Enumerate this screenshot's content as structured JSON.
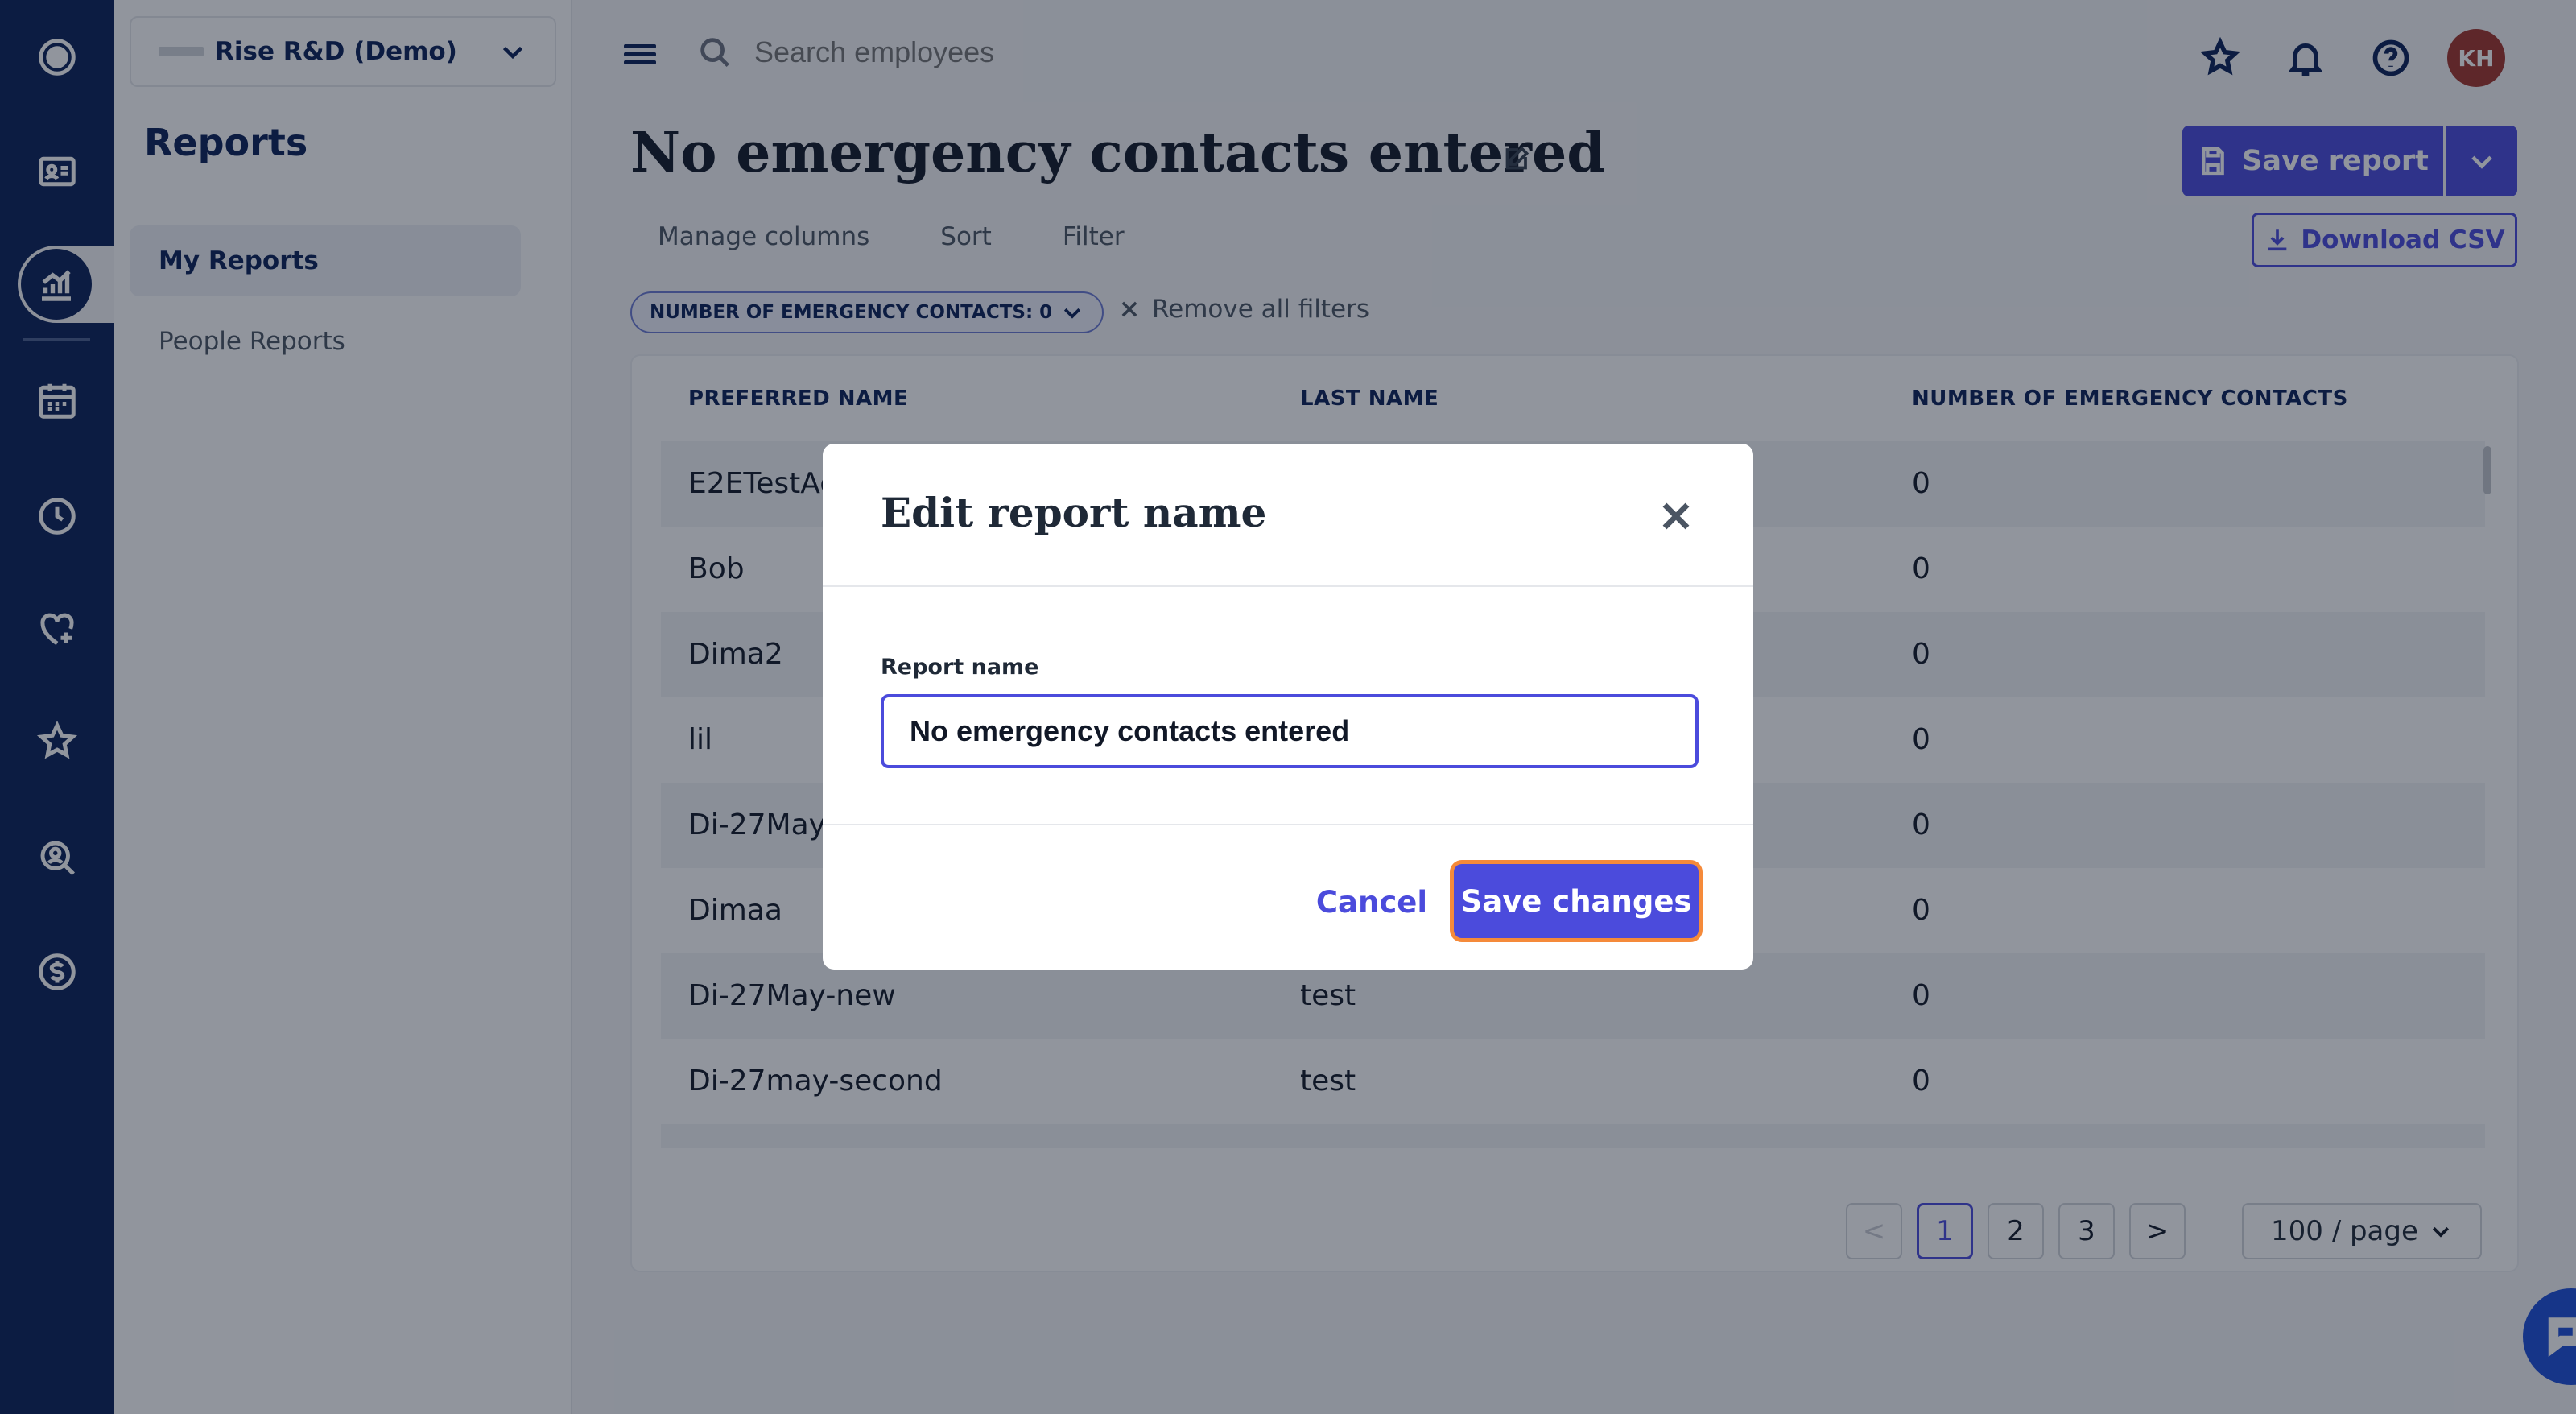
{
  "company": {
    "name": "Rise R&D (Demo)"
  },
  "sidenav": {
    "title": "Reports",
    "items": [
      {
        "label": "My Reports",
        "active": true
      },
      {
        "label": "People Reports",
        "active": false
      }
    ]
  },
  "rail_icons": [
    "logo-icon",
    "directory-icon",
    "reports-icon",
    "calendar-icon",
    "time-icon",
    "benefits-icon",
    "performance-icon",
    "recruiting-icon",
    "payroll-icon"
  ],
  "topbar": {
    "search_placeholder": "Search employees",
    "avatar_initials": "KH"
  },
  "report": {
    "title": "No emergency contacts entered",
    "save_label": "Save report",
    "download_label": "Download CSV",
    "tabs": [
      "Manage columns",
      "Sort",
      "Filter"
    ],
    "filter_chip": "NUMBER OF EMERGENCY CONTACTS: 0",
    "remove_filters": "Remove all filters"
  },
  "table": {
    "headers": [
      "PREFERRED NAME",
      "LAST NAME",
      "NUMBER OF EMERGENCY CONTACTS"
    ],
    "rows": [
      [
        "E2ETestAc",
        "",
        "0"
      ],
      [
        "Bob",
        "",
        "0"
      ],
      [
        "Dima2",
        "",
        "0"
      ],
      [
        "lil",
        "",
        "0"
      ],
      [
        "Di-27May",
        "",
        "0"
      ],
      [
        "Dimaa",
        "",
        "0"
      ],
      [
        "Di-27May-new",
        "test",
        "0"
      ],
      [
        "Di-27may-second",
        "test",
        "0"
      ]
    ]
  },
  "pagination": {
    "pages": [
      "1",
      "2",
      "3"
    ],
    "current": "1",
    "prev": "<",
    "next": ">",
    "per_page": "100 / page"
  },
  "modal": {
    "title": "Edit report name",
    "field_label": "Report name",
    "field_value": "No emergency contacts entered",
    "cancel_label": "Cancel",
    "save_label": "Save changes"
  },
  "colors": {
    "primary": "#4b4bdc",
    "rail": "#0a2157",
    "focus_ring": "#f58a3a",
    "avatar": "#a1342c"
  }
}
